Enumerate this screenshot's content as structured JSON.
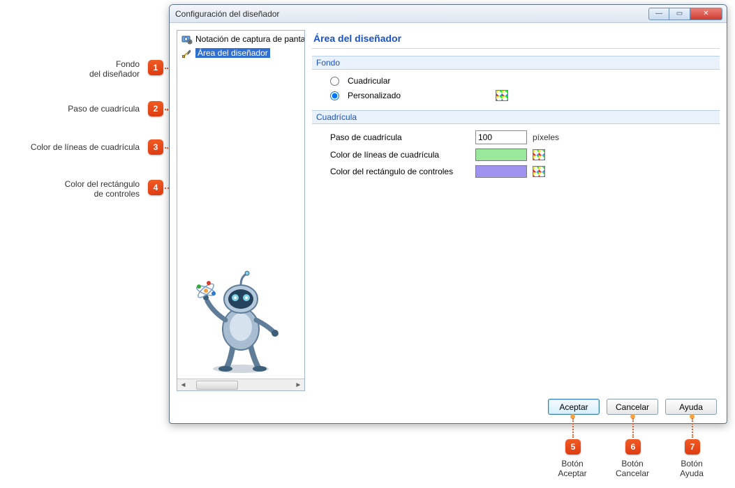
{
  "window": {
    "title": "Configuración del diseñador"
  },
  "tree": {
    "items": [
      {
        "icon": "camera-gear-icon",
        "label": "Notación de captura de pantal"
      },
      {
        "icon": "tools-icon",
        "label": "Área del diseñador",
        "selected": true
      }
    ]
  },
  "page": {
    "title": "Área del diseñador",
    "sections": {
      "fondo": {
        "head": "Fondo",
        "radio_cuadricular": "Cuadricular",
        "radio_personalizado": "Personalizado"
      },
      "cuadricula": {
        "head": "Cuadrícula",
        "step_label": "Paso de cuadrícula",
        "step_value": "100",
        "step_unit": "píxeles",
        "line_color_label": "Color de líneas de cuadrícula",
        "line_color": "#9ae89b",
        "rect_color_label": "Color del rectángulo de controles",
        "rect_color": "#9e94ef"
      }
    }
  },
  "buttons": {
    "accept": "Aceptar",
    "cancel": "Cancelar",
    "help": "Ayuda"
  },
  "callouts": {
    "c1": "Fondo\ndel diseñador",
    "c2": "Paso de cuadrícula",
    "c3": "Color de líneas de cuadrícula",
    "c4": "Color del rectángulo\nde controles",
    "c5": "Botón\nAceptar",
    "c6": "Botón\nCancelar",
    "c7": "Botón\nAyuda"
  }
}
